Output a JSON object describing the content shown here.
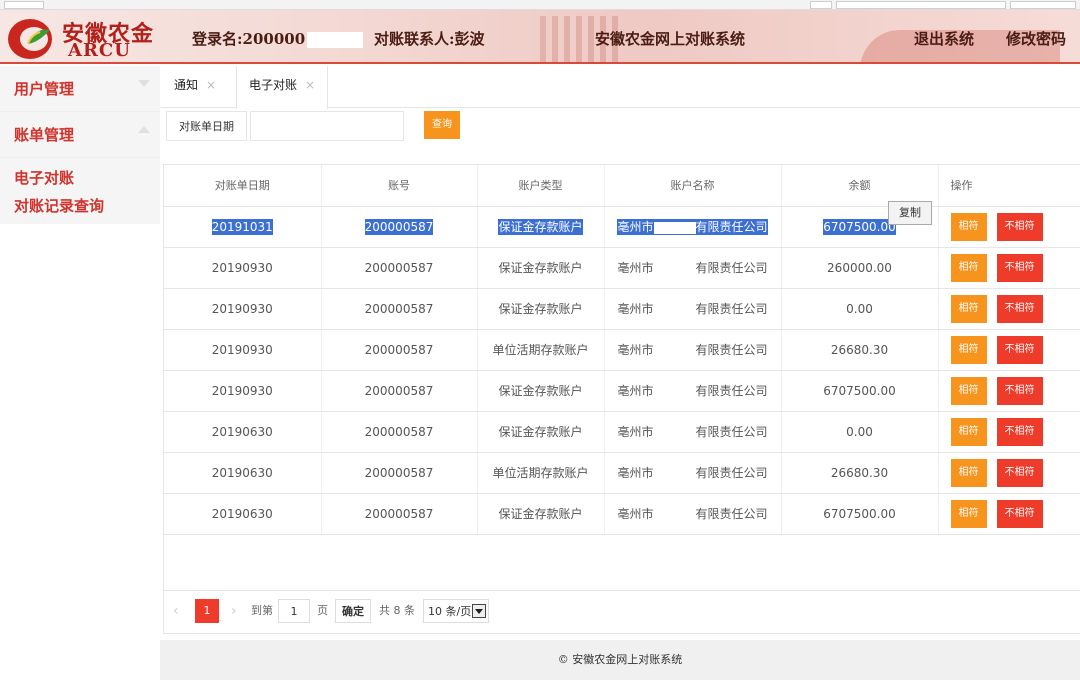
{
  "header": {
    "logo_cn": "安徽农金",
    "logo_en": "ARCU",
    "login_label": "登录名:",
    "login_value": "200000",
    "contact_label": "对账联系人:",
    "contact_value": "彭波",
    "system_title": "安徽农金网上对账系统",
    "logout_label": "退出系统",
    "change_password_label": "修改密码"
  },
  "sidebar": {
    "groups": [
      {
        "label": "用户管理"
      },
      {
        "label": "账单管理"
      }
    ],
    "sub_items": [
      {
        "label": "电子对账"
      },
      {
        "label": "对账记录查询"
      }
    ]
  },
  "tabs": [
    {
      "label": "通知"
    },
    {
      "label": "电子对账"
    }
  ],
  "filter": {
    "date_label": "对账单日期",
    "date_value": "",
    "query_label": "查询"
  },
  "table": {
    "headers": [
      "对账单日期",
      "账号",
      "账户类型",
      "账户名称",
      "余额",
      "操作"
    ],
    "rows": [
      {
        "date": "20191031",
        "account": "200000587",
        "type": "保证金存款账户",
        "name_prefix": "亳州市",
        "name_suffix": "有限责任公司",
        "balance": "6707500.00",
        "selected": true
      },
      {
        "date": "20190930",
        "account": "200000587",
        "type": "保证金存款账户",
        "name_prefix": "亳州市",
        "name_suffix": "有限责任公司",
        "balance": "260000.00",
        "selected": false
      },
      {
        "date": "20190930",
        "account": "200000587",
        "type": "保证金存款账户",
        "name_prefix": "亳州市",
        "name_suffix": "有限责任公司",
        "balance": "0.00",
        "selected": false
      },
      {
        "date": "20190930",
        "account": "200000587",
        "type": "单位活期存款账户",
        "name_prefix": "亳州市",
        "name_suffix": "有限责任公司",
        "balance": "26680.30",
        "selected": false
      },
      {
        "date": "20190930",
        "account": "200000587",
        "type": "保证金存款账户",
        "name_prefix": "亳州市",
        "name_suffix": "有限责任公司",
        "balance": "6707500.00",
        "selected": false
      },
      {
        "date": "20190630",
        "account": "200000587",
        "type": "保证金存款账户",
        "name_prefix": "亳州市",
        "name_suffix": "有限责任公司",
        "balance": "0.00",
        "selected": false
      },
      {
        "date": "20190630",
        "account": "200000587",
        "type": "单位活期存款账户",
        "name_prefix": "亳州市",
        "name_suffix": "有限责任公司",
        "balance": "26680.30",
        "selected": false
      },
      {
        "date": "20190630",
        "account": "200000587",
        "type": "保证金存款账户",
        "name_prefix": "亳州市",
        "name_suffix": "有限责任公司",
        "balance": "6707500.00",
        "selected": false
      }
    ],
    "op_match": "相符",
    "op_mismatch": "不相符",
    "copy_popup": "复制"
  },
  "pagination": {
    "prev": "‹",
    "current": "1",
    "next": "›",
    "goto_label": "到第",
    "page_input": "1",
    "page_unit": "页",
    "confirm": "确定",
    "total": "共 8 条",
    "page_size": "10 条/页"
  },
  "footer": {
    "text": "© 安徽农金网上对账系统"
  },
  "colors": {
    "brand_red": "#d0342c",
    "orange": "#f7941d",
    "button_red": "#ee3b2a",
    "selection": "#3c6fd4"
  }
}
